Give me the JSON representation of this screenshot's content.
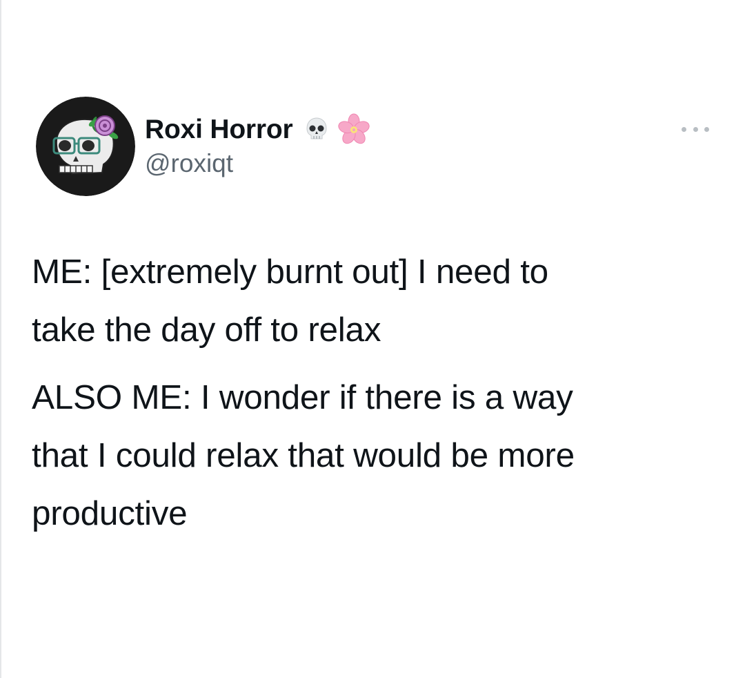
{
  "tweet": {
    "author": {
      "display_name": "Roxi Horror",
      "handle": "@roxiqt",
      "name_emojis": [
        "skull-emoji",
        "cherry-blossom-emoji"
      ],
      "avatar": "skull-with-glasses-and-rose-avatar"
    },
    "menu_icon": "more-options-icon",
    "paragraphs": [
      {
        "lines": [
          "ME: [extremely burnt out] I need to",
          "take the day off to relax"
        ]
      },
      {
        "lines": [
          "ALSO ME: I wonder if there is a way",
          "that I could relax that would be more",
          "productive"
        ]
      }
    ]
  },
  "colors": {
    "text": "#0f1419",
    "handle": "#5b6670",
    "more_dots": "#b8bec3",
    "background": "#ffffff"
  }
}
